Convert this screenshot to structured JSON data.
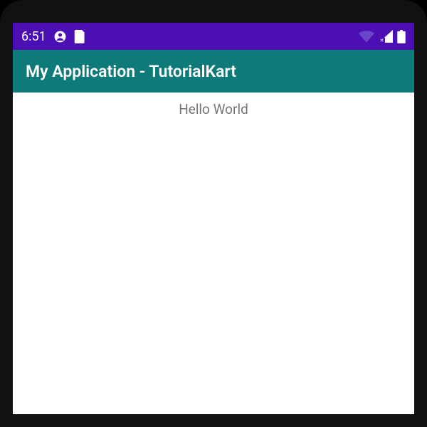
{
  "statusbar": {
    "time": "6:51"
  },
  "appbar": {
    "title": "My Application - TutorialKart"
  },
  "content": {
    "greeting": "Hello World"
  }
}
